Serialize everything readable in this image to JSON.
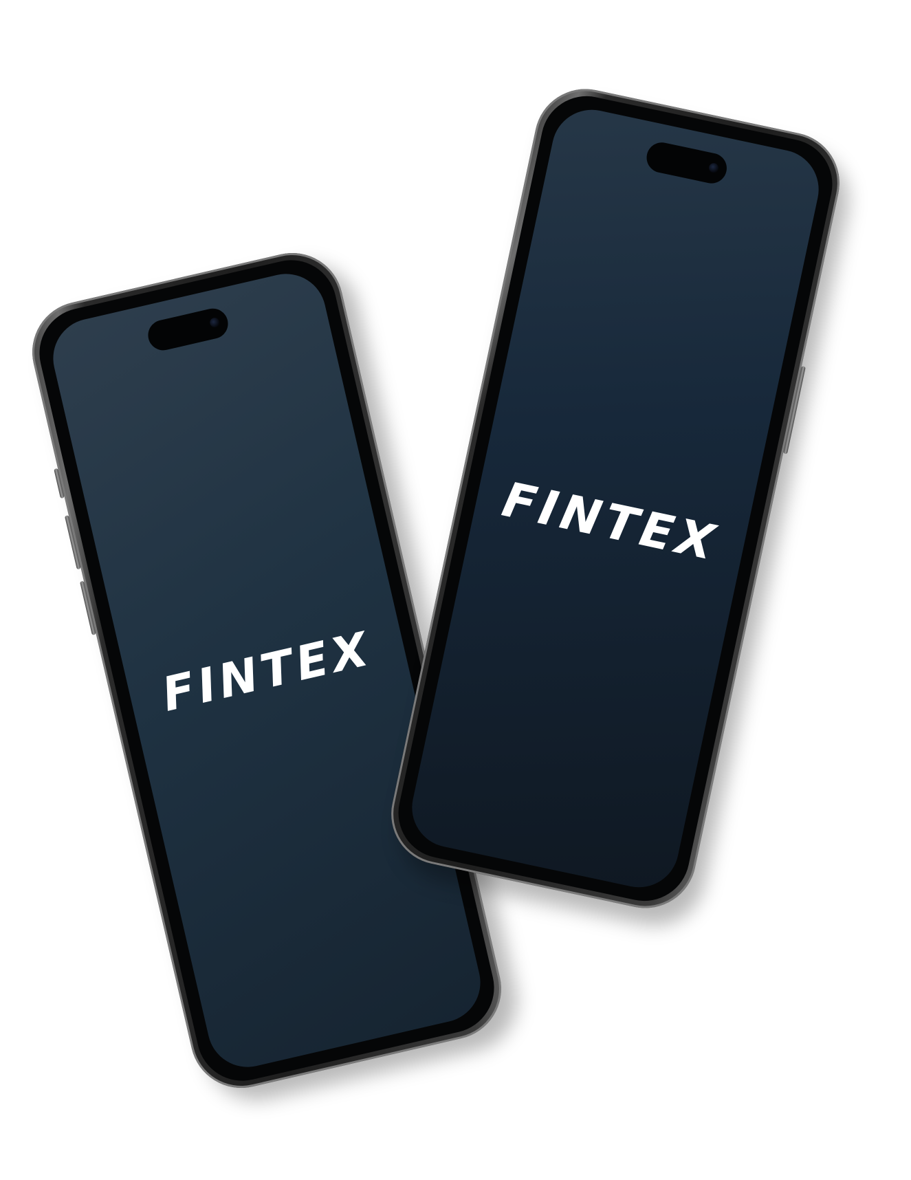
{
  "phones": [
    {
      "id": "back",
      "brand": "FINTEX"
    },
    {
      "id": "front",
      "brand": "FINTEX"
    }
  ],
  "colors": {
    "background": "#ffffff",
    "screen_dark": "#0f1822",
    "screen_light": "#2e3e4d",
    "frame": "#1e1e1e",
    "brand_text": "#ffffff"
  },
  "icons": [
    "camera-notch-icon"
  ]
}
